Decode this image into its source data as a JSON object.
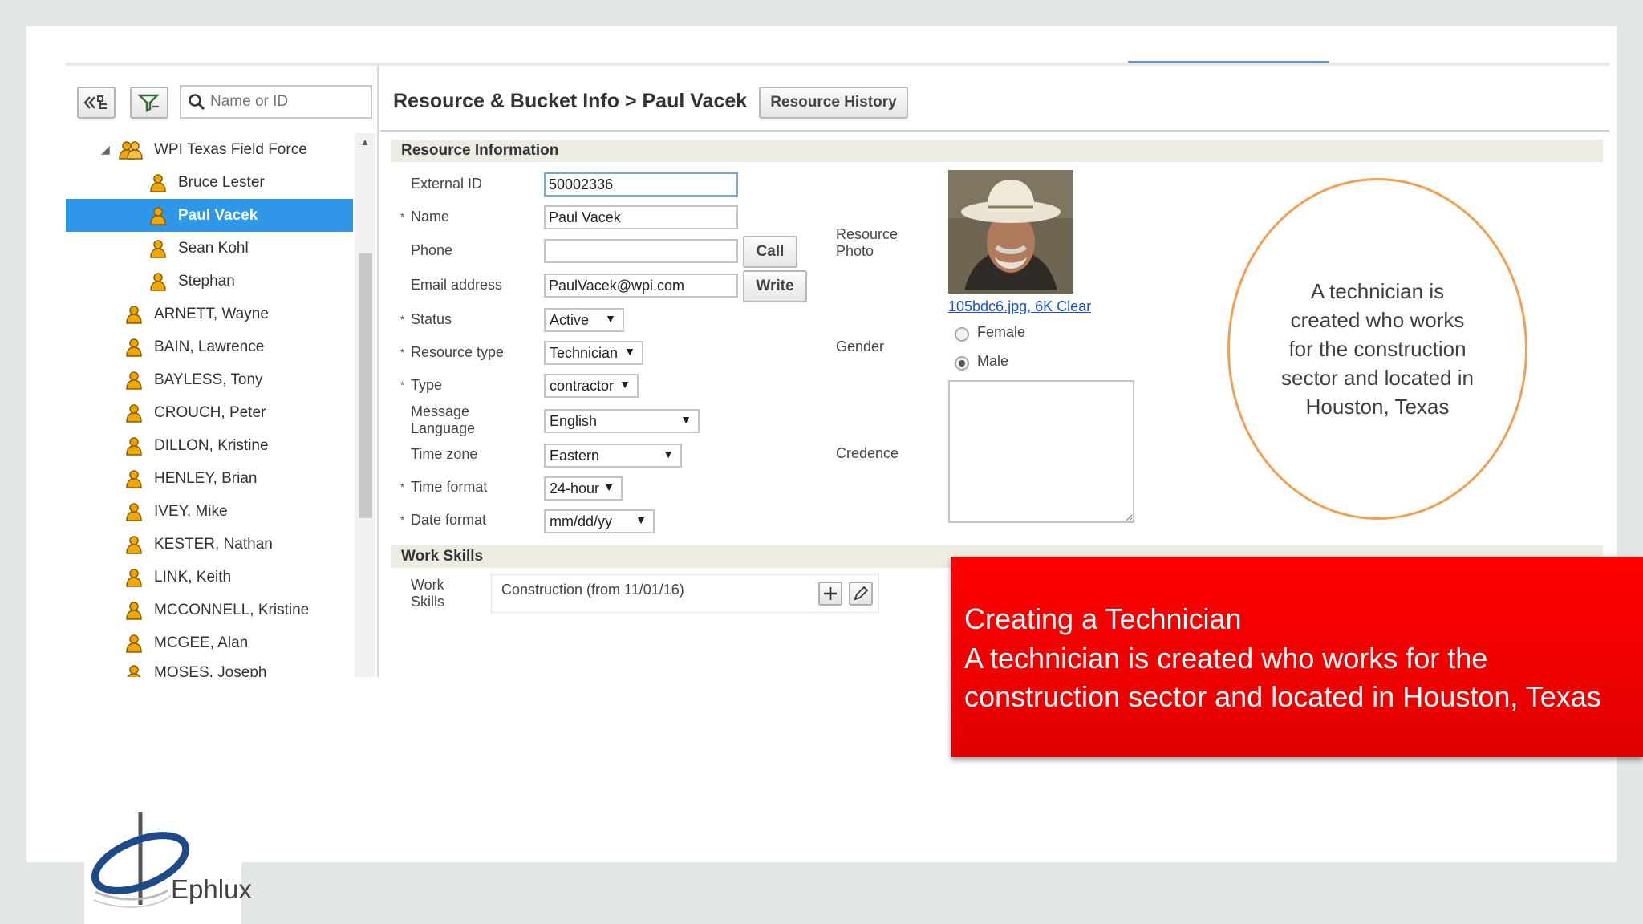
{
  "left_panel": {
    "search_placeholder": "Name or ID",
    "tree": {
      "root": "WPI Texas Field Force",
      "children": [
        "Bruce Lester",
        "Paul Vacek",
        "Sean Kohl",
        "Stephan"
      ],
      "selected": "Paul Vacek",
      "resources": [
        "ARNETT, Wayne",
        "BAIN, Lawrence",
        "BAYLESS, Tony",
        "CROUCH, Peter",
        "DILLON, Kristine",
        "HENLEY, Brian",
        "IVEY, Mike",
        "KESTER, Nathan",
        "LINK, Keith",
        "MCCONNELL, Kristine",
        "MCGEE, Alan",
        "MOSES, Joseph"
      ]
    }
  },
  "header": {
    "title": "Resource & Bucket Info > Paul Vacek",
    "history_button": "Resource History"
  },
  "resource_info": {
    "section_title": "Resource Information",
    "external_id": {
      "label": "External ID",
      "value": "50002336"
    },
    "name": {
      "label": "Name",
      "value": "Paul Vacek"
    },
    "phone": {
      "label": "Phone",
      "value": "",
      "button": "Call"
    },
    "email": {
      "label": "Email address",
      "value": "PaulVacek@wpi.com",
      "button": "Write"
    },
    "status": {
      "label": "Status",
      "value": "Active"
    },
    "resource_type": {
      "label": "Resource type",
      "value": "Technician"
    },
    "type": {
      "label": "Type",
      "value": "contractor"
    },
    "message_language": {
      "label_line1": "Message",
      "label_line2": "Language",
      "value": "English"
    },
    "time_zone": {
      "label": "Time zone",
      "value": "Eastern"
    },
    "time_format": {
      "label": "Time format",
      "value": "24-hour"
    },
    "date_format": {
      "label": "Date format",
      "value": "mm/dd/yy"
    },
    "photo": {
      "label_line1": "Resource",
      "label_line2": "Photo",
      "file_link": "105bdc6.jpg, 6K",
      "clear_link": "Clear"
    },
    "gender": {
      "label": "Gender",
      "options": [
        "Female",
        "Male"
      ],
      "selected": "Male"
    },
    "credence": {
      "label": "Credence",
      "value": ""
    }
  },
  "work_skills": {
    "section_title": "Work Skills",
    "label_line1": "Work",
    "label_line2": "Skills",
    "value": "Construction (from 11/01/16)"
  },
  "annotations": {
    "circle_text": "A technician is created who works for the construction sector and located in Houston, Texas",
    "banner_line1": "Creating a Technician",
    "banner_line2": "A technician is created who works for the",
    "banner_line3": "construction sector and located in Houston, Texas"
  },
  "logo": {
    "text": "Ephlux"
  },
  "colors": {
    "selection": "#2f97e8",
    "banner": "#ff0000",
    "circle_border": "#f0a050",
    "link": "#1a4fd6"
  }
}
